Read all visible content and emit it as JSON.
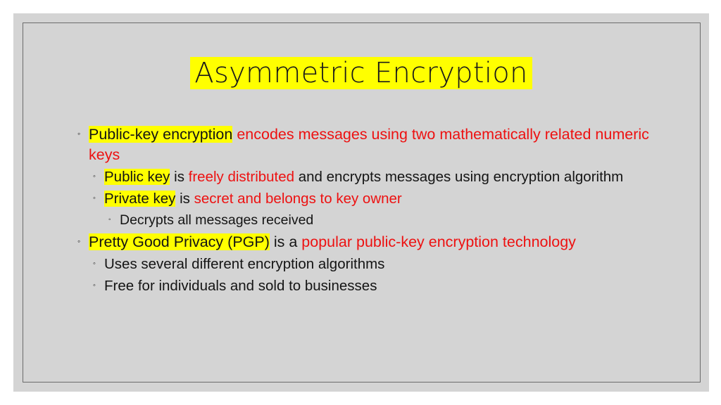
{
  "slide": {
    "title": "Asymmetric Encryption",
    "background_color": "#d4d4d4",
    "highlight_color": "#ffff00",
    "accent_red": "#ed1111",
    "text_color": "#141414",
    "bullet_glyph": "◦",
    "bullets": [
      {
        "level": 1,
        "segments": [
          {
            "text": "Public-key encryption",
            "style": "hl"
          },
          {
            "text": " encodes messages using two mathematically related numeric keys",
            "style": "red"
          }
        ]
      },
      {
        "level": 2,
        "segments": [
          {
            "text": "Public key",
            "style": "hl"
          },
          {
            "text": " is ",
            "style": "black"
          },
          {
            "text": "freely distributed",
            "style": "red"
          },
          {
            "text": " and encrypts messages using encryption algorithm",
            "style": "black"
          }
        ]
      },
      {
        "level": 2,
        "segments": [
          {
            "text": "Private key",
            "style": "hl"
          },
          {
            "text": " is ",
            "style": "black"
          },
          {
            "text": "secret and belongs to key owner",
            "style": "red"
          }
        ]
      },
      {
        "level": 3,
        "segments": [
          {
            "text": "Decrypts all messages received",
            "style": "black"
          }
        ]
      },
      {
        "level": 1,
        "segments": [
          {
            "text": "Pretty Good Privacy (PGP)",
            "style": "hl"
          },
          {
            "text": " is a ",
            "style": "black"
          },
          {
            "text": "popular public-key encryption technology",
            "style": "red"
          }
        ]
      },
      {
        "level": 2,
        "segments": [
          {
            "text": "Uses several different encryption algorithms",
            "style": "black"
          }
        ]
      },
      {
        "level": 2,
        "segments": [
          {
            "text": "Free for individuals and sold to businesses",
            "style": "black"
          }
        ]
      }
    ]
  }
}
